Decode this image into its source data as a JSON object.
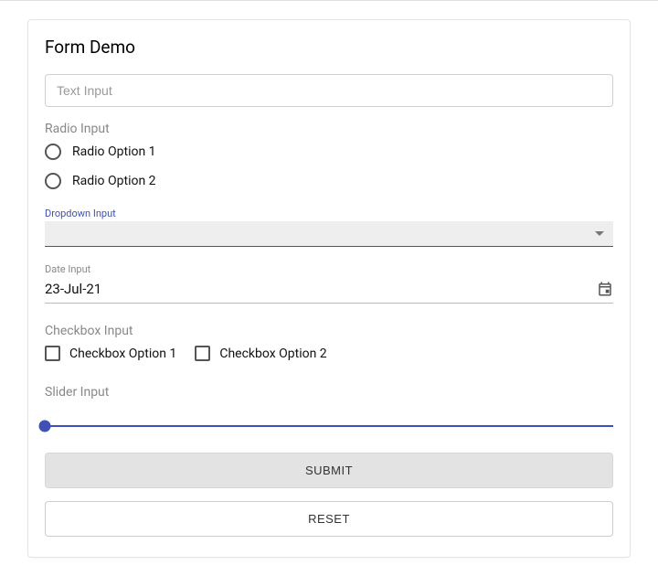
{
  "title": "Form Demo",
  "textInput": {
    "placeholder": "Text Input"
  },
  "radio": {
    "label": "Radio Input",
    "options": [
      "Radio Option 1",
      "Radio Option 2"
    ]
  },
  "dropdown": {
    "label": "Dropdown Input",
    "value": ""
  },
  "date": {
    "label": "Date Input",
    "value": "23-Jul-21"
  },
  "checkbox": {
    "label": "Checkbox Input",
    "options": [
      "Checkbox Option 1",
      "Checkbox Option 2"
    ]
  },
  "slider": {
    "label": "Slider Input"
  },
  "buttons": {
    "submit": "SUBMIT",
    "reset": "RESET"
  }
}
